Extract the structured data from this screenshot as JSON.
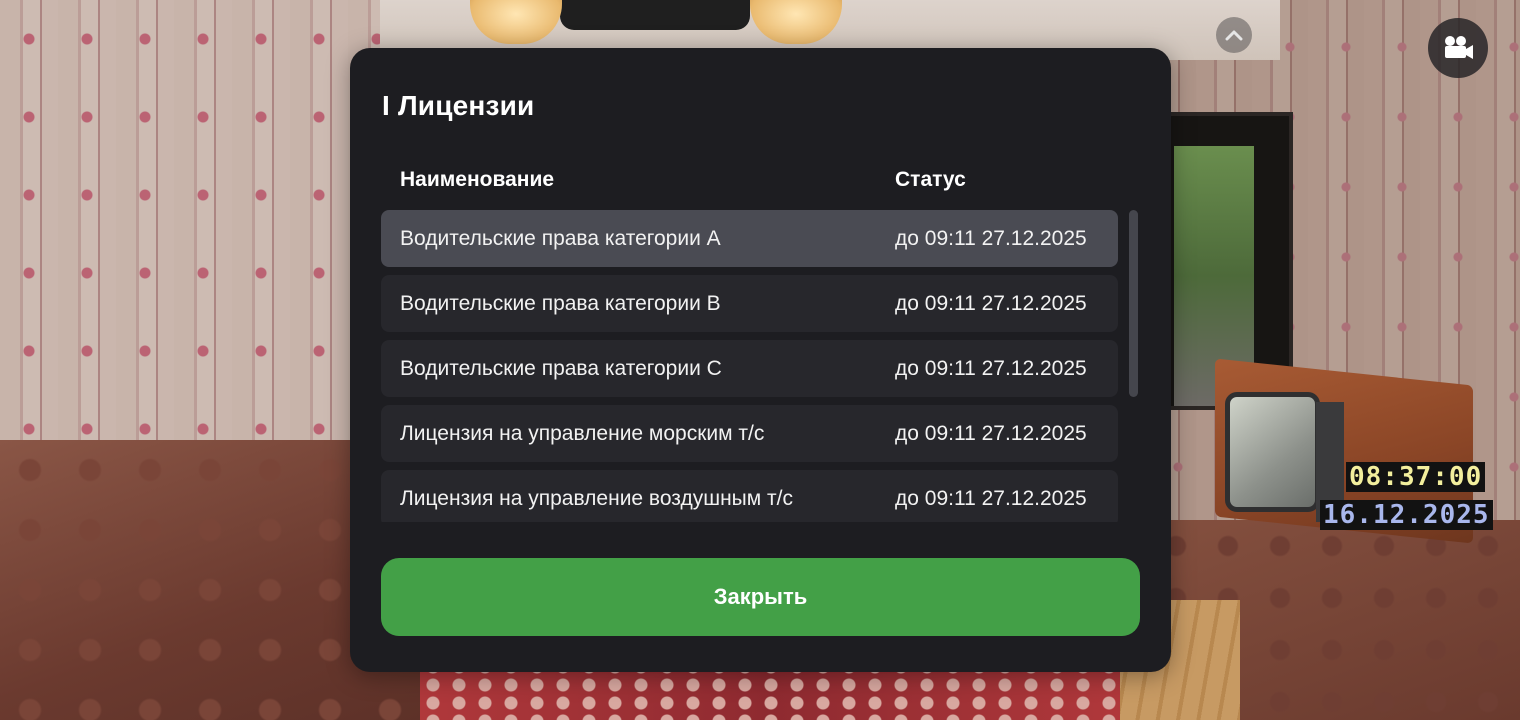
{
  "modal": {
    "title": "I Лицензии",
    "columns": {
      "name": "Наименование",
      "status": "Статус"
    },
    "rows": [
      {
        "name": "Водительские права категории A",
        "status": "до 09:11 27.12.2025"
      },
      {
        "name": "Водительские права категории B",
        "status": "до 09:11 27.12.2025"
      },
      {
        "name": "Водительские права категории C",
        "status": "до 09:11 27.12.2025"
      },
      {
        "name": "Лицензия на управление морским т/с",
        "status": "до 09:11 27.12.2025"
      },
      {
        "name": "Лицензия на управление воздушным т/с",
        "status": "до 09:11 27.12.2025"
      }
    ],
    "close_label": "Закрыть"
  },
  "hud": {
    "time": "08:37:00",
    "date": "16.12.2025",
    "icons": {
      "collapse": "chevron-up-icon",
      "camera": "video-camera-icon"
    }
  },
  "colors": {
    "panel": "#1d1d21",
    "row": "#27272c",
    "row_selected": "#4a4b53",
    "accent": "#43a047",
    "clock_time": "#f3ef9d",
    "clock_date": "#a9b7ec"
  }
}
